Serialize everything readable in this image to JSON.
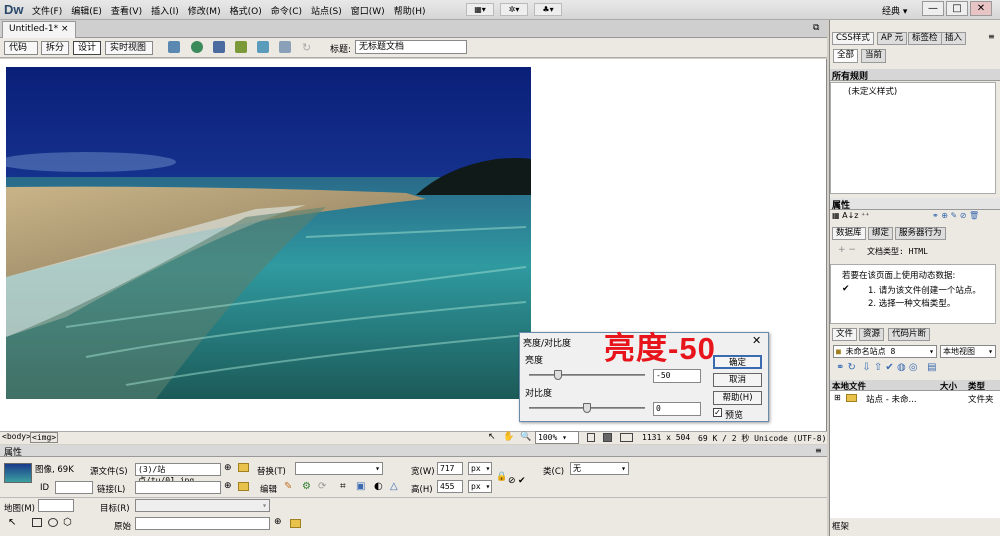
{
  "app": {
    "logo": "Dw",
    "workspace": "经典 ▾",
    "win_min": "—",
    "win_max": "□",
    "win_close": "✕"
  },
  "menu": [
    "文件(F)",
    "编辑(E)",
    "查看(V)",
    "插入(I)",
    "修改(M)",
    "格式(O)",
    "命令(C)",
    "站点(S)",
    "窗口(W)",
    "帮助(H)"
  ],
  "toolbar_icons": [
    "▦▾",
    "✲▾",
    "♣▾"
  ],
  "document": {
    "tab": "Untitled-1*",
    "tab_close": "×",
    "views": [
      "代码",
      "拆分",
      "设计",
      "实时视图"
    ],
    "title_label": "标题:",
    "title_value": "无标题文档"
  },
  "statusbar": {
    "tags": [
      "<body>",
      "<img>"
    ],
    "zoom": "100%",
    "dims": "1131 x 504",
    "info": "69 K / 2 秒  Unicode (UTF-8)"
  },
  "properties": {
    "header": "属性",
    "image_label": "图像, 69K",
    "src_label": "源文件(S)",
    "src_value": "(3)/站点/tu/01.jpg",
    "alt_label": "替换(T)",
    "alt_value": "",
    "width_label": "宽(W)",
    "width_value": "717",
    "width_unit": "px ▾",
    "height_label": "高(H)",
    "height_value": "455",
    "height_unit": "px ▾",
    "class_label": "类(C)",
    "class_value": "无",
    "id_label": "ID",
    "link_label": "链接(L)",
    "edit_label": "编辑",
    "map_label": "地图(M)",
    "target_label": "目标(R)",
    "original_label": "原始"
  },
  "right_panel": {
    "css_tabs": [
      "CSS样式",
      "AP 元",
      "标签检",
      "插入"
    ],
    "css_subtabs": [
      "全部",
      "当前"
    ],
    "all_rules_header": "所有规则",
    "rule_item": "(未定义样式)",
    "attr_header": "属性",
    "db_tabs": [
      "数据库",
      "绑定",
      "服务器行为"
    ],
    "doctype_label": "文档类型: HTML",
    "dyn_intro": "若要在该页面上使用动态数据:",
    "dyn_steps": [
      "1. 请为该文件创建一个站点。",
      "2. 选择一种文档类型。"
    ],
    "file_tabs": [
      "文件",
      "资源",
      "代码片断"
    ],
    "site_name": "未命名站点 8",
    "view_name": "本地视图",
    "col_local": "本地文件",
    "col_size": "大小",
    "col_type": "类型",
    "site_row": "站点 - 未命...",
    "site_row_type": "文件夹",
    "footer": "框架"
  },
  "dialog": {
    "title": "亮度/对比度",
    "close": "✕",
    "brightness_label": "亮度",
    "brightness_value": "-50",
    "brightness_level": -50,
    "contrast_label": "对比度",
    "contrast_value": "0",
    "contrast_level": 0,
    "ok": "确定",
    "cancel": "取消",
    "help": "帮助(H)",
    "preview_label": "预览",
    "preview_checked": true
  },
  "annotation": "亮度-50",
  "colors": {
    "annotation": "#e8141c",
    "canvas_bg": "#ffffff",
    "chrome": "#ece9e3"
  }
}
